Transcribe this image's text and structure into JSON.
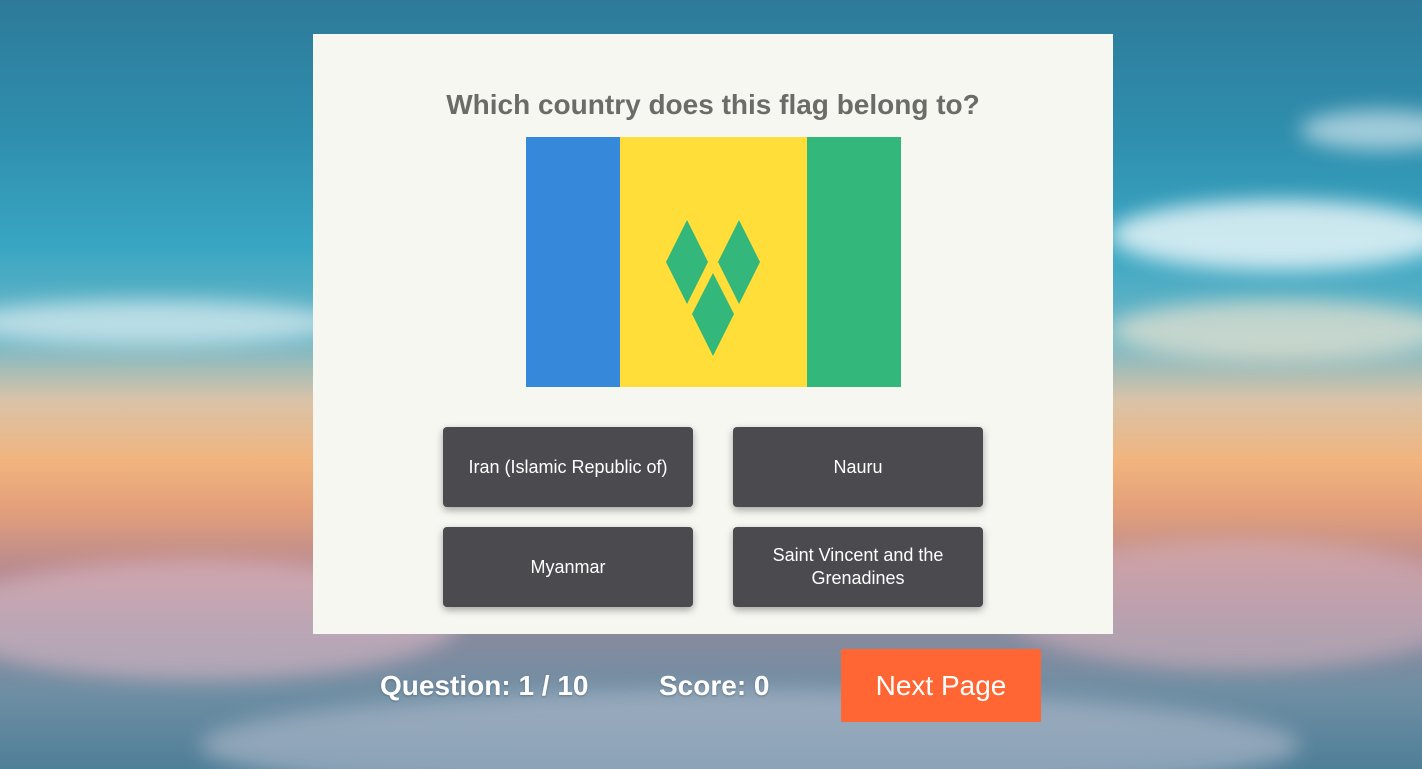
{
  "quiz": {
    "question": "Which country does this flag belong to?",
    "flag": {
      "name": "Saint Vincent and the Grenadines flag",
      "colors": {
        "blue": "#3689da",
        "yellow": "#ffde39",
        "green": "#34b77a"
      }
    },
    "answers": [
      {
        "label": "Iran (Islamic Republic of)"
      },
      {
        "label": "Nauru"
      },
      {
        "label": "Myanmar"
      },
      {
        "label": "Saint Vincent and the Grenadines"
      }
    ]
  },
  "footer": {
    "question_progress": "Question: 1 / 10",
    "score": "Score: 0",
    "next_label": "Next Page"
  },
  "colors": {
    "card_bg": "#f7f7f2",
    "title_text": "#6b6b68",
    "answer_bg": "#4a4a4f",
    "next_bg": "#ff6633"
  }
}
